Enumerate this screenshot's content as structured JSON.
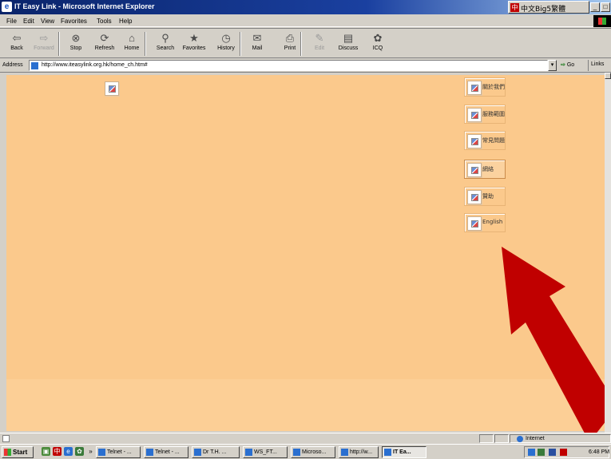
{
  "window": {
    "title": "IT Easy Link - Microsoft Internet Explorer",
    "ime_label": "中文Big5繁體",
    "buttons": [
      "_",
      "□",
      "×"
    ]
  },
  "menu": [
    "File",
    "Edit",
    "View",
    "Favorites",
    "Tools",
    "Help"
  ],
  "toolbar": [
    {
      "label": "Back",
      "icon": "back-arrow-icon",
      "glyph": "⇦",
      "enabled": true
    },
    {
      "label": "Forward",
      "icon": "forward-arrow-icon",
      "glyph": "⇨",
      "enabled": false
    },
    {
      "label": "Stop",
      "icon": "stop-icon",
      "glyph": "⊗",
      "enabled": true
    },
    {
      "label": "Refresh",
      "icon": "refresh-icon",
      "glyph": "⟳",
      "enabled": true
    },
    {
      "label": "Home",
      "icon": "home-icon",
      "glyph": "⌂",
      "enabled": true
    },
    {
      "label": "Search",
      "icon": "search-icon",
      "glyph": "⚲",
      "enabled": true
    },
    {
      "label": "Favorites",
      "icon": "favorites-icon",
      "glyph": "★",
      "enabled": true
    },
    {
      "label": "History",
      "icon": "history-icon",
      "glyph": "◷",
      "enabled": true
    },
    {
      "label": "Mail",
      "icon": "mail-icon",
      "glyph": "✉",
      "enabled": true
    },
    {
      "label": "Print",
      "icon": "print-icon",
      "glyph": "⎙",
      "enabled": true
    },
    {
      "label": "Edit",
      "icon": "edit-icon",
      "glyph": "✎",
      "enabled": false
    },
    {
      "label": "Discuss",
      "icon": "discuss-icon",
      "glyph": "▤",
      "enabled": true
    },
    {
      "label": "ICQ",
      "icon": "icq-flower-icon",
      "glyph": "✿",
      "enabled": true
    }
  ],
  "address": {
    "label": "Address",
    "url": "http://www.iteasylink.org.hk/home_ch.htm#",
    "go_label": "Go",
    "links_label": "Links"
  },
  "page": {
    "nav_items": [
      {
        "label": "關於我們",
        "active": false
      },
      {
        "label": "服務範圍",
        "active": false
      },
      {
        "label": "常見問題",
        "active": false
      },
      {
        "label": "網絡",
        "active": true
      },
      {
        "label": "贊助",
        "active": false
      },
      {
        "label": "English",
        "active": false
      }
    ],
    "background_color": "#fbc98c",
    "arrow_color": "#c00000"
  },
  "status": {
    "zone": "Internet"
  },
  "taskbar": {
    "start_label": "Start",
    "quicklaunch_more": "»",
    "tasks": [
      {
        "label": "Telnet - ...",
        "active": false
      },
      {
        "label": "Telnet - ...",
        "active": false
      },
      {
        "label": "Dr T.H. ...",
        "active": false
      },
      {
        "label": "WS_FT...",
        "active": false
      },
      {
        "label": "Microso...",
        "active": false
      },
      {
        "label": "http://w...",
        "active": false
      },
      {
        "label": "IT Ea...",
        "active": true
      }
    ],
    "clock": "6:48 PM"
  }
}
